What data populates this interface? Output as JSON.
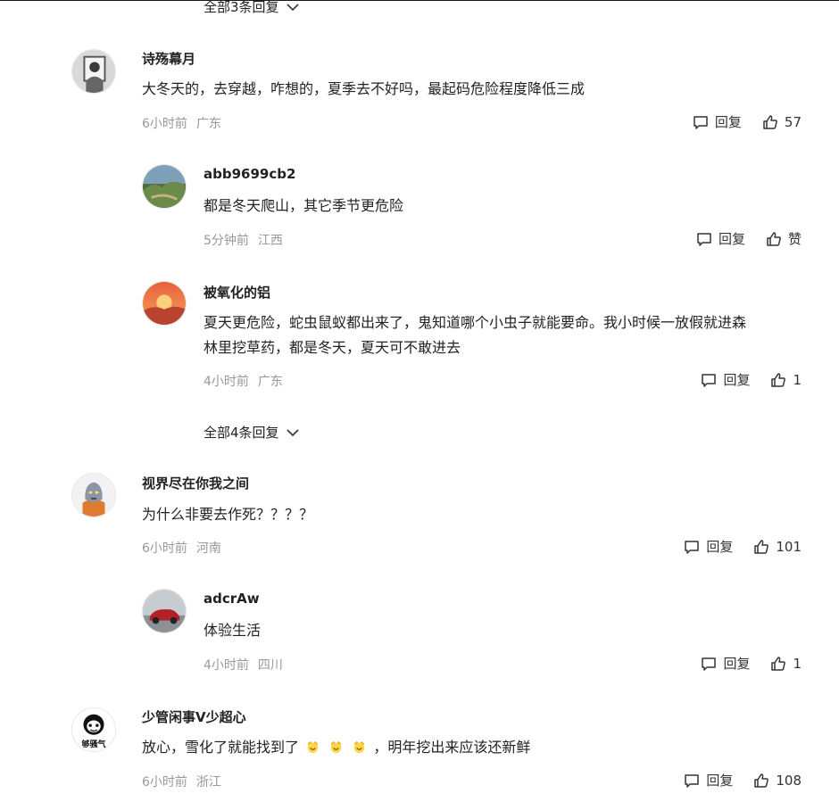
{
  "top_expand": {
    "label": "全部3条回复"
  },
  "mid_expand": {
    "label": "全部4条回复"
  },
  "comments": [
    {
      "name": "诗殇幕月",
      "text": "大冬天的，去穿越，咋想的，夏季去不好吗，最起码危险程度降低三成",
      "time": "6小时前",
      "location": "广东",
      "reply": "回复",
      "likes": "57"
    },
    {
      "name": "abb9699cb2",
      "text": "都是冬天爬山，其它季节更危险",
      "time": "5分钟前",
      "location": "江西",
      "reply": "回复",
      "likes": "赞"
    },
    {
      "name": "被氧化的铝",
      "text_line1": "夏天更危险，蛇虫鼠蚁都出来了，鬼知道哪个小虫子就能要命。我小时候一放假就进森",
      "text_line2": "林里挖草药，都是冬天，夏天可不敢进去",
      "time": "4小时前",
      "location": "广东",
      "reply": "回复",
      "likes": "1"
    },
    {
      "name": "视界尽在你我之间",
      "text": "为什么非要去作死？？？？",
      "time": "6小时前",
      "location": "河南",
      "reply": "回复",
      "likes": "101"
    },
    {
      "name": "adcrAw",
      "text": "体验生活",
      "time": "4小时前",
      "location": "四川",
      "reply": "回复",
      "likes": "1"
    },
    {
      "name": "少管闲事V少超心",
      "text_pre": "放心，雪化了就能找到了",
      "text_post": "，明年挖出来应该还新鲜",
      "avatar_caption": "够骚气",
      "time": "6小时前",
      "location": "浙江",
      "reply": "回复",
      "likes": "108"
    }
  ],
  "icons": {
    "reply": "comment-bubble-icon",
    "like": "thumbs-up-icon",
    "expand": "chevron-down-icon",
    "emoji": "crown-smile-emoji-icon"
  }
}
